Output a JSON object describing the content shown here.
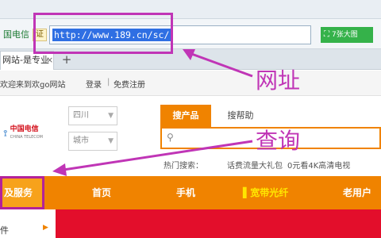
{
  "browser": {
    "identity_label": "国电信",
    "cert_badge": "证",
    "url": "http://www.189.cn/sc/",
    "right_button_label": "7张大图",
    "right_button_icon": "camera-icon",
    "tab_title": "网站-是专业",
    "tab_close": "×",
    "new_tab": "+"
  },
  "site": {
    "welcome": "欢迎来到欢go网站",
    "login": "登录",
    "separator": "|",
    "register": "免费注册",
    "logo_cn": "中国电信",
    "logo_en": "CHINA TELECOM",
    "province_select": "四川",
    "city_select": "城市",
    "search_tabs": [
      "搜产品",
      "搜帮助"
    ],
    "hot_label": "热门搜索：",
    "hot_items": [
      "话费流量大礼包",
      "0元看4K高清电视"
    ],
    "nav_first": "及服务",
    "nav_items": [
      "首页",
      "手机",
      "宽带光纤",
      "老用户"
    ],
    "side_item": "件",
    "side_arrow": "▶"
  },
  "annotations": {
    "url_note": "网址",
    "query_note": "查询"
  },
  "colors": {
    "accent_orange": "#f08300",
    "annotation_magenta": "#c035b6",
    "url_selection": "#2f6fe3",
    "banner_red": "#e30e2b"
  }
}
